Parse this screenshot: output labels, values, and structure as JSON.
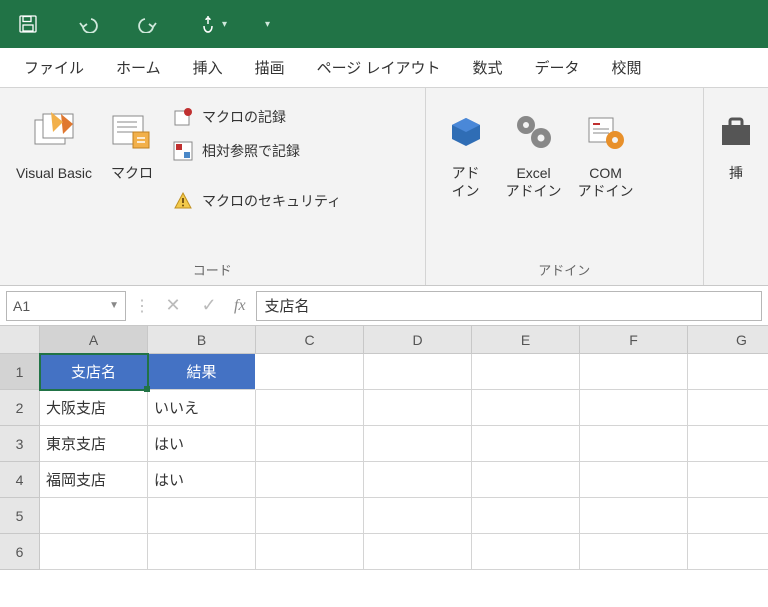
{
  "qat": {
    "save": "save-icon",
    "undo": "undo-icon",
    "redo": "redo-icon",
    "touch": "touch-icon"
  },
  "tabs": [
    "ファイル",
    "ホーム",
    "挿入",
    "描画",
    "ページ レイアウト",
    "数式",
    "データ",
    "校閲"
  ],
  "ribbon": {
    "group_code_label": "コード",
    "group_addin_label": "アドイン",
    "visual_basic": "Visual Basic",
    "macros": "マクロ",
    "record_macro": "マクロの記録",
    "relative_ref": "相対参照で記録",
    "macro_security": "マクロのセキュリティ",
    "addins": "アド\nイン",
    "excel_addins": "Excel\nアドイン",
    "com_addins": "COM\nアドイン",
    "insert_truncated": "挿"
  },
  "name_box": "A1",
  "fx_label": "fx",
  "formula_value": "支店名",
  "columns": [
    "A",
    "B",
    "C",
    "D",
    "E",
    "F",
    "G"
  ],
  "rows": [
    "1",
    "2",
    "3",
    "4",
    "5",
    "6"
  ],
  "cells": {
    "A1": "支店名",
    "B1": "結果",
    "A2": "大阪支店",
    "B2": "いいえ",
    "A3": "東京支店",
    "B3": "はい",
    "A4": "福岡支店",
    "B4": "はい"
  }
}
